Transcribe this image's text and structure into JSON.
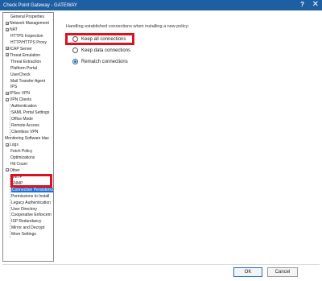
{
  "window": {
    "title": "Check Point Gateway - GATEWAY",
    "help_glyph": "?",
    "close_glyph": "✕"
  },
  "colors": {
    "titlebar": "#1e5fa3",
    "selection": "#1e6fd6",
    "highlight": "#e01020"
  },
  "nav": {
    "items": [
      {
        "label": "General Properties",
        "expander": ""
      },
      {
        "label": "Network Management",
        "expander": "+"
      },
      {
        "label": "NAT",
        "expander": "+"
      },
      {
        "label": "HTTPS Inspection",
        "expander": ""
      },
      {
        "label": "HTTP/HTTPS Proxy",
        "expander": ""
      },
      {
        "label": "ICAP Server",
        "expander": "+"
      },
      {
        "label": "Threat Emulation",
        "expander": "+"
      },
      {
        "label": "Threat Extraction",
        "expander": ""
      },
      {
        "label": "Platform Portal",
        "expander": ""
      },
      {
        "label": "UserCheck",
        "expander": ""
      },
      {
        "label": "Mail Transfer Agent",
        "expander": ""
      },
      {
        "label": "IPS",
        "expander": ""
      },
      {
        "label": "IPSec VPN",
        "expander": "+"
      },
      {
        "label": "VPN Clients",
        "expander": "−"
      },
      {
        "label": "Authentication",
        "expander": ""
      },
      {
        "label": "SAML Portal Settings",
        "expander": ""
      },
      {
        "label": "Office Mode",
        "expander": ""
      },
      {
        "label": "Remote Access",
        "expander": ""
      },
      {
        "label": "Clientless VPN",
        "expander": ""
      },
      {
        "label": "Monitoring Software blac",
        "expander": ""
      },
      {
        "label": "Logs",
        "expander": "+"
      },
      {
        "label": "Fetch Policy",
        "expander": ""
      },
      {
        "label": "Optimizations",
        "expander": ""
      },
      {
        "label": "Hit Count",
        "expander": ""
      },
      {
        "label": "Other",
        "expander": "−"
      },
      {
        "label": "SMTP",
        "expander": ""
      },
      {
        "label": "SNMP",
        "expander": ""
      },
      {
        "label": "Connection Persistence",
        "expander": ""
      },
      {
        "label": "Permissions to Install",
        "expander": ""
      },
      {
        "label": "Legacy Authentication",
        "expander": ""
      },
      {
        "label": "User Directory",
        "expander": ""
      },
      {
        "label": "Cooperative Enforcem",
        "expander": ""
      },
      {
        "label": "ISP Redundancy",
        "expander": ""
      },
      {
        "label": "Mirror and Decrypt",
        "expander": ""
      },
      {
        "label": "More Settings",
        "expander": ""
      }
    ],
    "selected_label": "Connection Persistence"
  },
  "main": {
    "heading": "Handling established connections when installing a new policy:",
    "options": [
      {
        "label": "Keep all connections",
        "checked": false
      },
      {
        "label": "Keep data connections",
        "checked": false
      },
      {
        "label": "Rematch connections",
        "checked": true
      }
    ]
  },
  "footer": {
    "ok_label": "OK",
    "cancel_label": "Cancel"
  }
}
